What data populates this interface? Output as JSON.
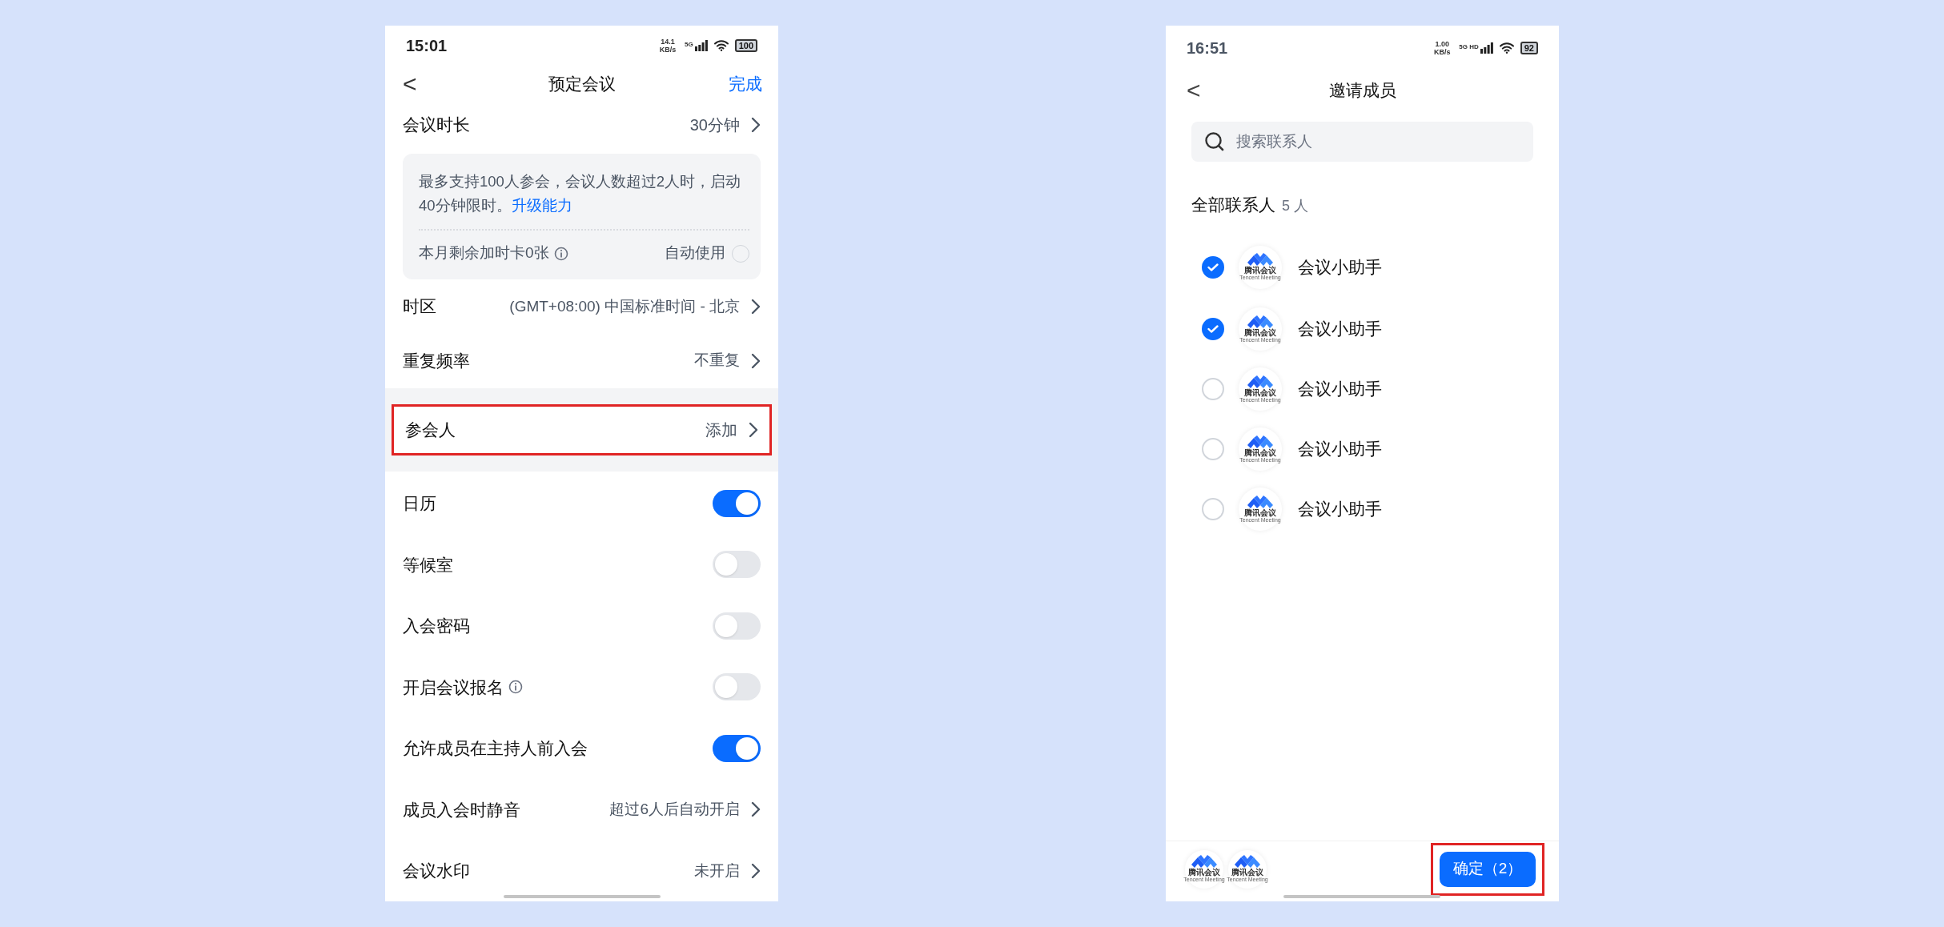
{
  "left_screen": {
    "status_bar": {
      "time": "15:01",
      "speed": "14.1 KB/s",
      "network": "5G",
      "battery": "100"
    },
    "header": {
      "back": "<",
      "title": "预定会议",
      "done": "完成"
    },
    "duration": {
      "label": "会议时长",
      "value": "30分钟"
    },
    "notice": {
      "text": "最多支持100人参会，会议人数超过2人时，启动40分钟限时。",
      "link": "升级能力",
      "card_label": "本月剩余加时卡0张",
      "auto_label": "自动使用",
      "auto_checked": false
    },
    "rows_top": [
      {
        "label": "时区",
        "value": "(GMT+08:00) 中国标准时间 - 北京"
      },
      {
        "label": "重复频率",
        "value": "不重复"
      }
    ],
    "participants": {
      "label": "参会人",
      "value": "添加",
      "highlighted": true
    },
    "settings": [
      {
        "kind": "toggle",
        "label": "日历",
        "on": true
      },
      {
        "kind": "toggle",
        "label": "等候室",
        "on": false
      },
      {
        "kind": "toggle",
        "label": "入会密码",
        "on": false
      },
      {
        "kind": "toggle",
        "label": "开启会议报名",
        "info": true,
        "on": false
      },
      {
        "kind": "toggle",
        "label": "允许成员在主持人前入会",
        "on": true
      },
      {
        "kind": "link",
        "label": "成员入会时静音",
        "value": "超过6人后自动开启"
      },
      {
        "kind": "link",
        "label": "会议水印",
        "value": "未开启"
      }
    ]
  },
  "right_screen": {
    "status_bar": {
      "time": "16:51",
      "speed": "1.00 KB/s",
      "network": "5G HD",
      "battery": "92"
    },
    "header": {
      "back": "<",
      "title": "邀请成员"
    },
    "search": {
      "placeholder": "搜索联系人"
    },
    "section": {
      "title": "全部联系人",
      "count": "5 人"
    },
    "contacts": [
      {
        "name": "会议小助手",
        "logo": "腾讯会议",
        "logo_sub": "Tencent Meeting",
        "selected": true
      },
      {
        "name": "会议小助手",
        "logo": "腾讯会议",
        "logo_sub": "Tencent Meeting",
        "selected": true
      },
      {
        "name": "会议小助手",
        "logo": "腾讯会议",
        "logo_sub": "Tencent Meeting",
        "selected": false
      },
      {
        "name": "会议小助手",
        "logo": "腾讯会议",
        "logo_sub": "Tencent Meeting",
        "selected": false
      },
      {
        "name": "会议小助手",
        "logo": "腾讯会议",
        "logo_sub": "Tencent Meeting",
        "selected": false
      }
    ],
    "selected_avatars": [
      {
        "logo": "腾讯会议",
        "logo_sub": "Tencent Meeting"
      },
      {
        "logo": "腾讯会议",
        "logo_sub": "Tencent Meeting"
      }
    ],
    "confirm": {
      "label": "确定（2）",
      "highlighted": true
    }
  }
}
